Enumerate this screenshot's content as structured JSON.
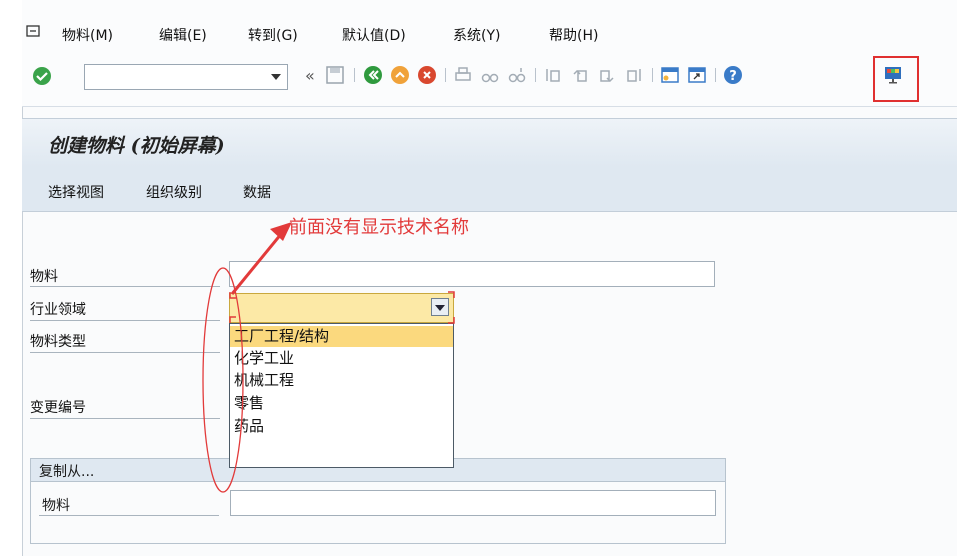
{
  "menu": {
    "items": [
      "物料(M)",
      "编辑(E)",
      "转到(G)",
      "默认值(D)",
      "系统(Y)",
      "帮助(H)"
    ]
  },
  "toolbar": {
    "command_value": "",
    "nav_back": "«"
  },
  "screen": {
    "title": "创建物料 (初始屏幕)",
    "app_toolbar": [
      "选择视图",
      "组织级别",
      "数据"
    ]
  },
  "form": {
    "material_label": "物料",
    "material_value": "",
    "industry_label": "行业领域",
    "industry_value": "",
    "material_type_label": "物料类型",
    "change_number_label": "变更编号"
  },
  "industry_options": [
    "工厂工程/结构",
    "化学工业",
    "机械工程",
    "零售",
    "药品"
  ],
  "copy_from": {
    "header": "复制从...",
    "material_label": "物料",
    "material_value": ""
  },
  "annotation": {
    "text": "前面没有显示技术名称"
  },
  "colors": {
    "accent_red": "#e23a3a",
    "selection": "#fbd97e",
    "field_highlight": "#fce9a6"
  }
}
